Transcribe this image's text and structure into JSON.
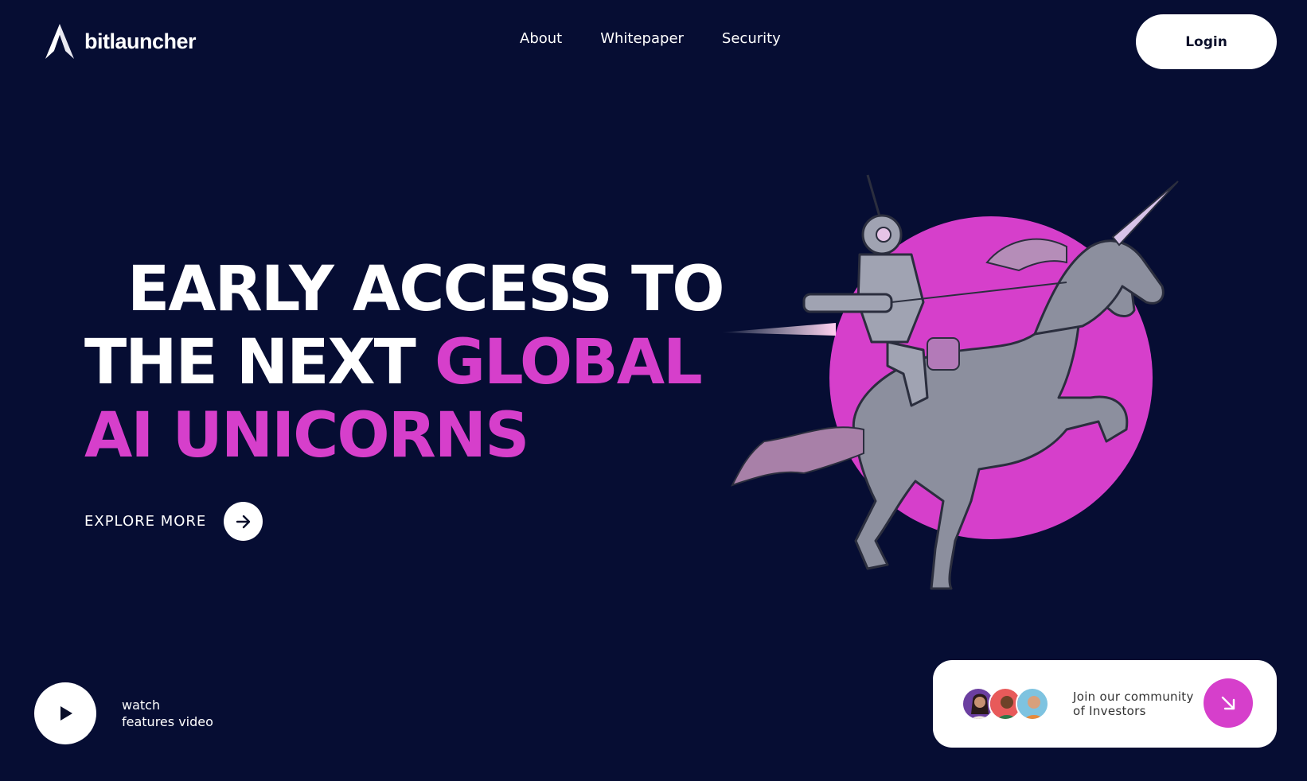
{
  "brand": {
    "name": "bitlauncher"
  },
  "nav": {
    "items": [
      {
        "label": "About"
      },
      {
        "label": "Whitepaper"
      },
      {
        "label": "Security"
      }
    ]
  },
  "header": {
    "login_label": "Login"
  },
  "hero": {
    "line1": "EARLY ACCESS TO",
    "line2_white": "THE NEXT ",
    "line2_accent": "GLOBAL",
    "line3_accent": "AI UNICORNS",
    "explore_label": "EXPLORE MORE",
    "illustration": "robot-riding-unicorn"
  },
  "video": {
    "line1": "watch",
    "line2": "features video"
  },
  "community": {
    "line1": "Join our community",
    "line2": "of Investors"
  },
  "colors": {
    "background": "#060d33",
    "accent": "#d63fcb",
    "white": "#ffffff"
  }
}
